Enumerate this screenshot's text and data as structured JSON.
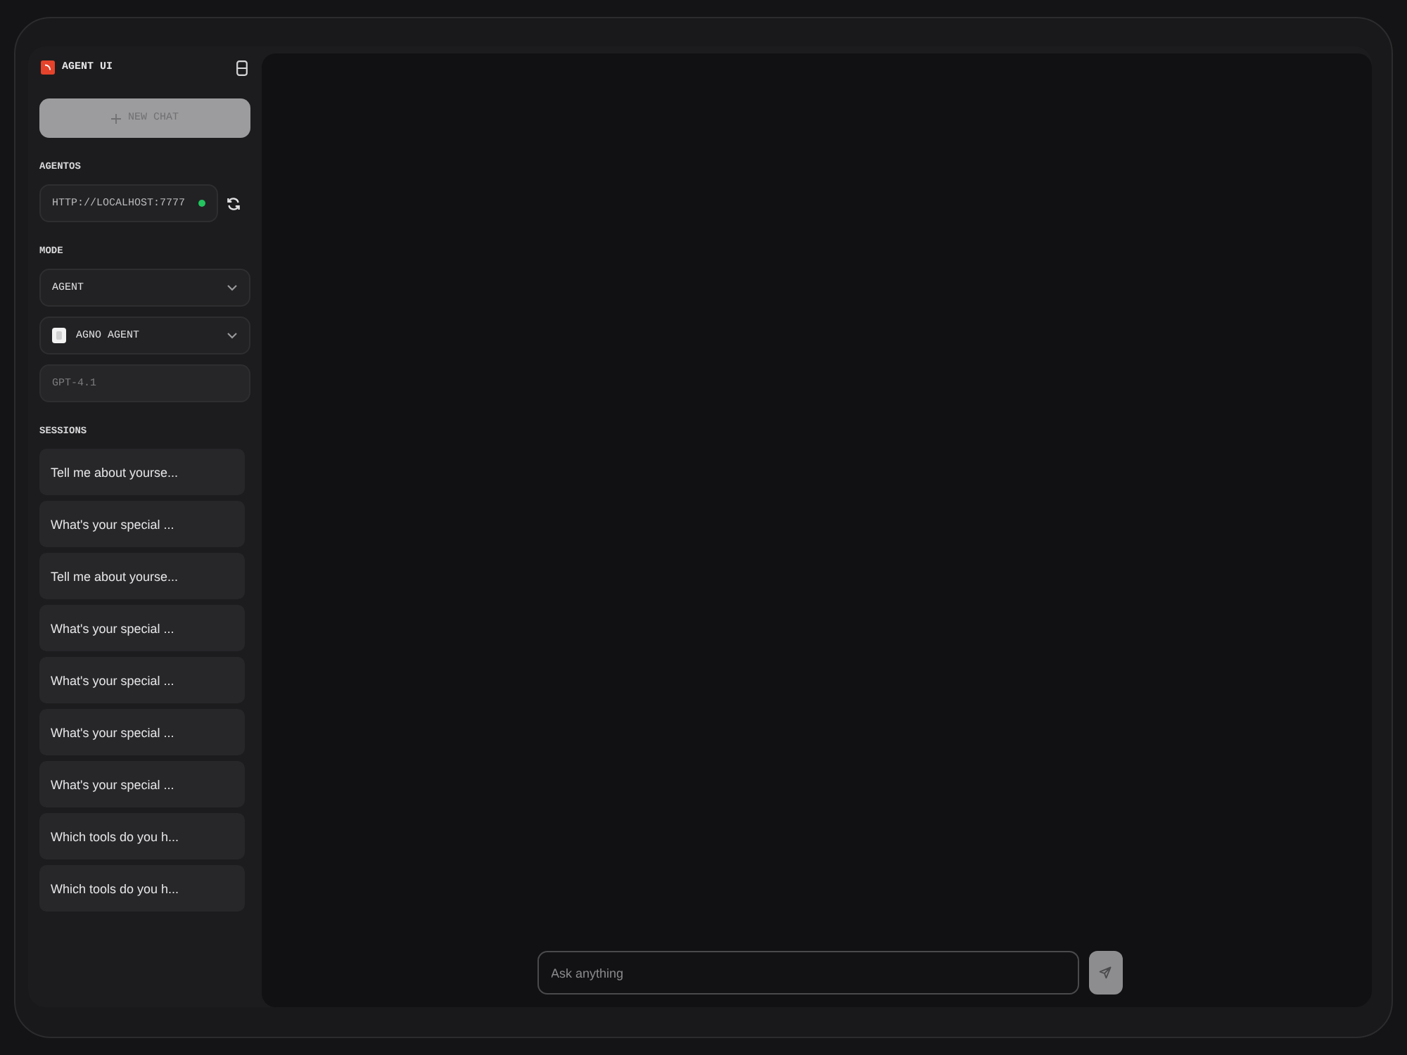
{
  "header": {
    "title": "AGENT UI"
  },
  "new_chat_button": {
    "label": "NEW CHAT"
  },
  "agentos": {
    "label": "AGENTOS",
    "endpoint": "HTTP://LOCALHOST:7777",
    "connected": true
  },
  "mode": {
    "label": "MODE",
    "mode_select": "AGENT",
    "agent_select": "AGNO AGENT",
    "model": "GPT-4.1"
  },
  "sessions": {
    "label": "SESSIONS",
    "items": [
      {
        "title": "Tell me about yourse..."
      },
      {
        "title": "What's your special ..."
      },
      {
        "title": "Tell me about yourse..."
      },
      {
        "title": "What's your special ..."
      },
      {
        "title": "What's your special ..."
      },
      {
        "title": "What's your special ..."
      },
      {
        "title": "What's your special ..."
      },
      {
        "title": "Which tools do you h..."
      },
      {
        "title": "Which tools do you h..."
      }
    ]
  },
  "chat": {
    "placeholder": "Ask anything"
  }
}
